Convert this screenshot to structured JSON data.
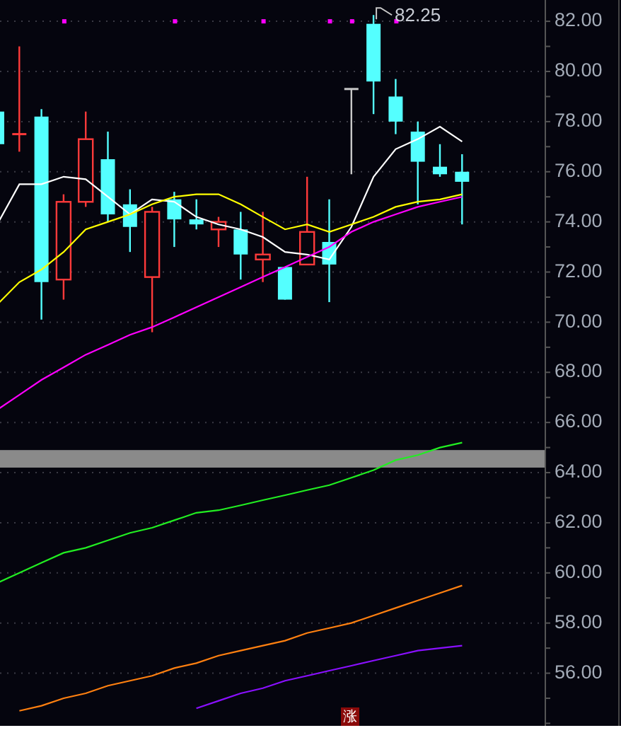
{
  "chart": {
    "chart_data": {
      "type": "candlestick",
      "ylim": [
        53.9,
        82.85
      ],
      "grid": true,
      "yticks": [
        {
          "value": 82,
          "label": "82.00"
        },
        {
          "value": 80,
          "label": "80.00"
        },
        {
          "value": 78,
          "label": "78.00"
        },
        {
          "value": 76,
          "label": "76.00"
        },
        {
          "value": 74,
          "label": "74.00"
        },
        {
          "value": 72,
          "label": "72.00"
        },
        {
          "value": 70,
          "label": "70.00"
        },
        {
          "value": 68,
          "label": "68.00"
        },
        {
          "value": 66,
          "label": "66.00"
        },
        {
          "value": 64,
          "label": "64.00"
        },
        {
          "value": 62,
          "label": "62.00"
        },
        {
          "value": 60,
          "label": "60.00"
        },
        {
          "value": 58,
          "label": "58.00"
        },
        {
          "value": 56,
          "label": "56.00"
        }
      ],
      "ohlc": [
        [
          78.4,
          78.4,
          77.1,
          77.1
        ],
        [
          77.5,
          81.0,
          76.8,
          77.5
        ],
        [
          78.2,
          78.5,
          70.1,
          71.6
        ],
        [
          71.7,
          75.1,
          70.9,
          74.8
        ],
        [
          74.8,
          78.4,
          74.6,
          77.3
        ],
        [
          76.5,
          77.6,
          74.0,
          74.3
        ],
        [
          74.7,
          75.3,
          72.8,
          73.8
        ],
        [
          71.8,
          74.6,
          69.6,
          74.4
        ],
        [
          74.9,
          75.2,
          73.0,
          74.1
        ],
        [
          74.1,
          74.9,
          73.7,
          73.9
        ],
        [
          73.7,
          74.2,
          73.0,
          74.0
        ],
        [
          73.7,
          74.4,
          71.7,
          72.7
        ],
        [
          72.5,
          74.4,
          71.6,
          72.7
        ],
        [
          72.2,
          72.2,
          70.9,
          70.9
        ],
        [
          72.3,
          75.8,
          72.3,
          73.6
        ],
        [
          73.2,
          74.9,
          70.8,
          72.3
        ],
        [
          79.3,
          79.3,
          75.9,
          79.3
        ],
        [
          81.9,
          82.25,
          78.3,
          79.6
        ],
        [
          79.0,
          79.7,
          77.5,
          78.0
        ],
        [
          77.6,
          78.0,
          74.7,
          76.4
        ],
        [
          76.2,
          77.1,
          75.8,
          75.9
        ],
        [
          76.0,
          76.7,
          73.9,
          75.6
        ]
      ],
      "series": [
        {
          "type": "line",
          "color": "#ffffff",
          "values": [
            73.9,
            75.5,
            75.5,
            75.8,
            75.7,
            75.0,
            74.3,
            74.9,
            74.8,
            74.2,
            73.9,
            73.7,
            73.4,
            72.8,
            72.7,
            72.5,
            73.8,
            75.8,
            76.9,
            77.3,
            77.8,
            77.2
          ]
        },
        {
          "type": "line",
          "color": "#ffff00",
          "values": [
            70.7,
            71.6,
            72.1,
            72.8,
            73.7,
            74.0,
            74.3,
            74.7,
            75.0,
            75.1,
            75.1,
            74.7,
            74.2,
            73.7,
            73.9,
            73.6,
            73.9,
            74.2,
            74.6,
            74.8,
            74.9,
            75.1
          ]
        },
        {
          "type": "line",
          "color": "#ff00ff",
          "values": [
            66.5,
            67.1,
            67.7,
            68.2,
            68.7,
            69.1,
            69.5,
            69.8,
            70.2,
            70.6,
            71.0,
            71.4,
            71.8,
            72.2,
            72.6,
            73.0,
            73.6,
            74.0,
            74.3,
            74.6,
            74.8,
            75.0
          ]
        },
        {
          "type": "line",
          "color": "#22ee22",
          "values": [
            59.6,
            60.0,
            60.4,
            60.8,
            61.0,
            61.3,
            61.6,
            61.8,
            62.1,
            62.4,
            62.5,
            62.7,
            62.9,
            63.1,
            63.3,
            63.5,
            63.8,
            64.1,
            64.5,
            64.7,
            65.0,
            65.2
          ]
        },
        {
          "type": "line",
          "color": "#ff8010",
          "values": [
            null,
            54.5,
            54.7,
            55.0,
            55.2,
            55.5,
            55.7,
            55.9,
            56.2,
            56.4,
            56.7,
            56.9,
            57.1,
            57.3,
            57.6,
            57.8,
            58.0,
            58.3,
            58.6,
            58.9,
            59.2,
            59.5
          ]
        },
        {
          "type": "line",
          "color": "#8a10ff",
          "values": [
            null,
            null,
            null,
            null,
            null,
            null,
            null,
            null,
            null,
            54.6,
            54.9,
            55.2,
            55.4,
            55.7,
            55.9,
            56.1,
            56.3,
            56.5,
            56.7,
            56.9,
            57.0,
            57.1
          ]
        },
        {
          "type": "scatter",
          "color": "#ff00ff",
          "values": [
            null,
            null,
            null,
            82,
            null,
            null,
            null,
            null,
            82,
            null,
            null,
            null,
            82,
            null,
            null,
            82,
            82,
            null,
            82,
            null,
            null,
            null
          ]
        }
      ],
      "bands": [
        {
          "axis": "y",
          "from": 64.2,
          "to": 64.9,
          "color": "#8a8a8a"
        }
      ],
      "annotations": [
        "82.25"
      ]
    },
    "badge": "涨"
  }
}
